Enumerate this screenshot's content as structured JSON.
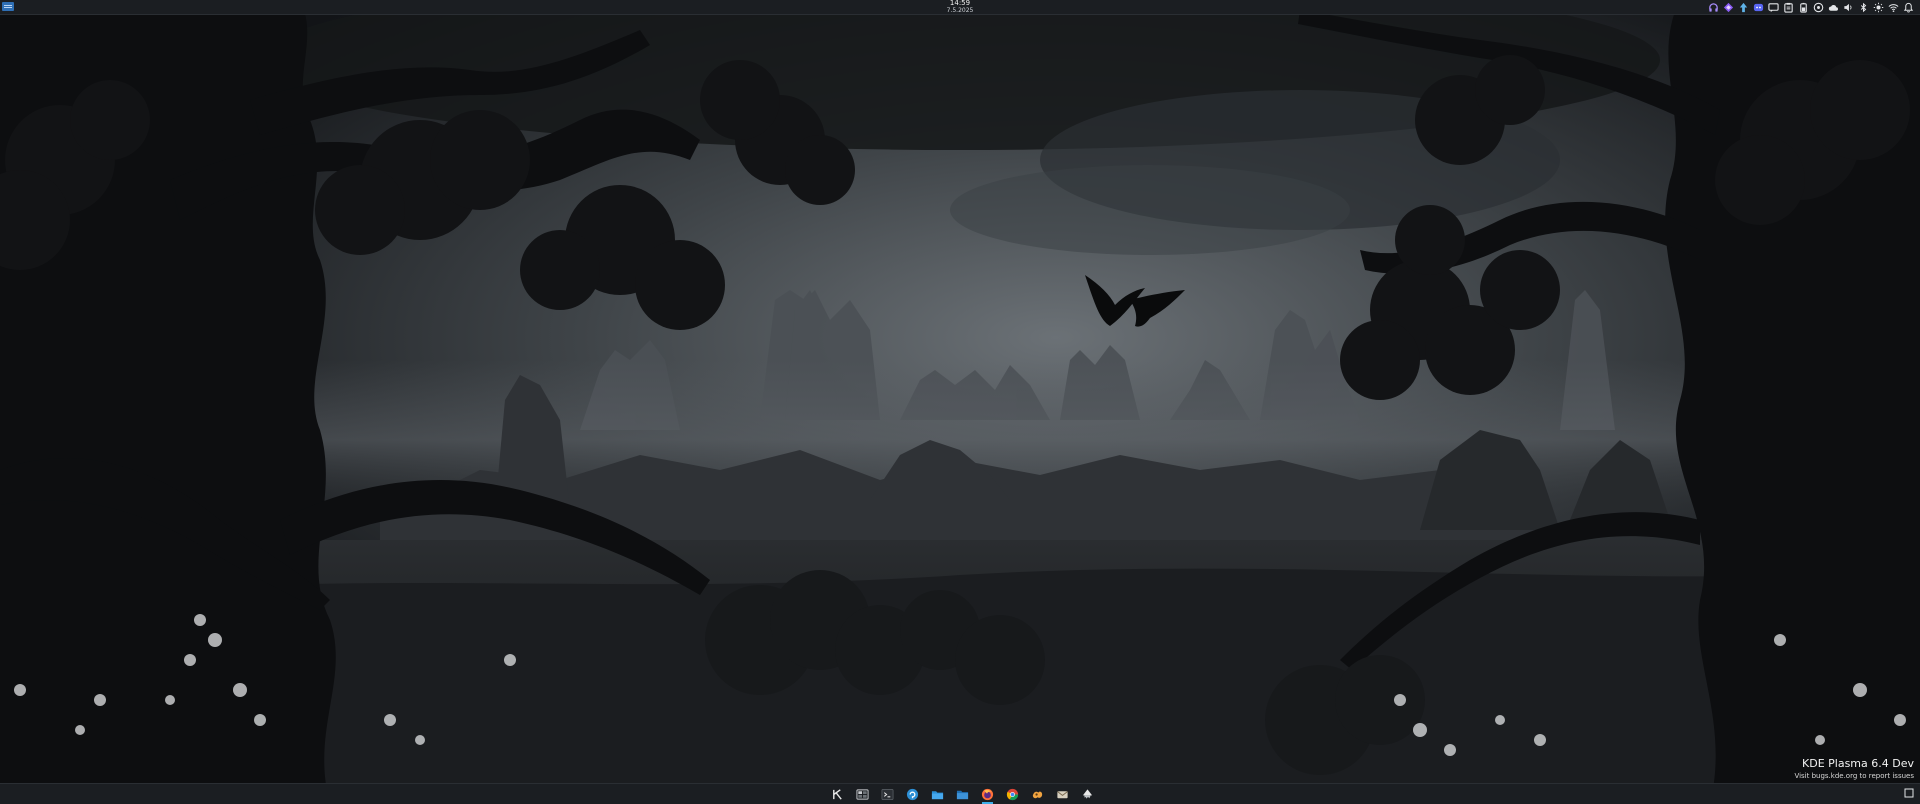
{
  "panel_top": {
    "clock": {
      "time": "14:59",
      "date": "7.5.2025"
    },
    "launcher_icon": "application-launcher-icon",
    "systray_icons": [
      "headphones-icon",
      "purple-diamond-app-icon",
      "network-upload-icon",
      "discord-icon",
      "messages-icon",
      "clipboard-icon",
      "battery-icon",
      "media-player-icon",
      "weather-icon",
      "volume-icon",
      "bluetooth-icon",
      "brightness-icon",
      "wifi-icon",
      "notifications-icon"
    ]
  },
  "watermark": {
    "title": "KDE Plasma 6.4 Dev",
    "subtitle": "Visit bugs.kde.org to report issues"
  },
  "panel_bottom": {
    "tasks": [
      {
        "name": "kde-app-launcher-icon",
        "active": false
      },
      {
        "name": "virtual-desktop-pager-icon",
        "active": false
      },
      {
        "name": "konsole-terminal-icon",
        "active": false
      },
      {
        "name": "discover-app-store-icon",
        "active": false
      },
      {
        "name": "dolphin-folder-icon",
        "active": false
      },
      {
        "name": "system-file-manager-icon",
        "active": false
      },
      {
        "name": "firefox-icon",
        "active": true
      },
      {
        "name": "chrome-icon",
        "active": false
      },
      {
        "name": "spectacle-app-icon",
        "active": false
      },
      {
        "name": "email-app-icon",
        "active": false
      },
      {
        "name": "inkscape-icon",
        "active": false
      }
    ],
    "show_desktop_icon": "show-desktop-icon"
  },
  "colors": {
    "panel": "#1b1e22",
    "accent": "#3daee9"
  }
}
